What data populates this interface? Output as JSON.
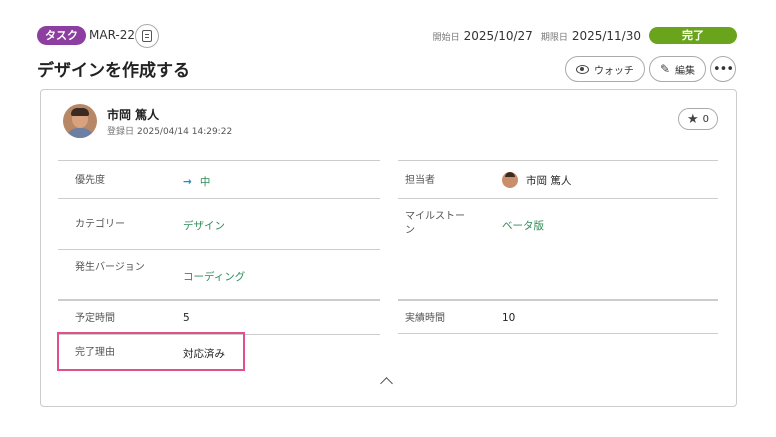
{
  "issue": {
    "type_label": "タスク",
    "key": "MAR-22",
    "title": "デザインを作成する",
    "start_label": "開始日",
    "start_date": "2025/10/27",
    "due_label": "期限日",
    "due_date": "2025/11/30",
    "status": "完了"
  },
  "actions": {
    "watch_label": "ウォッチ",
    "edit_label": "編集",
    "more_label": "•••"
  },
  "author": {
    "name": "市岡 篤人",
    "created_label": "登録日",
    "created_at": "2025/04/14 14:29:22",
    "star_count": "0"
  },
  "fields": {
    "priority": {
      "label": "優先度",
      "value": "中",
      "arrow": "→"
    },
    "assignee": {
      "label": "担当者",
      "value": "市岡 篤人"
    },
    "category": {
      "label": "カテゴリー",
      "value": "デザイン"
    },
    "milestone": {
      "label": "マイルストーン",
      "value": "ベータ版"
    },
    "version": {
      "label": "発生バージョン",
      "value": "コーディング"
    },
    "estimated": {
      "label": "予定時間",
      "value": "5"
    },
    "actual": {
      "label": "実績時間",
      "value": "10"
    },
    "resolution": {
      "label": "完了理由",
      "value": "対応済み"
    }
  },
  "colors": {
    "type_badge": "#8c3fa0",
    "status_done": "#6aa41d",
    "link_green": "#2e8b57",
    "highlight": "#e0508a"
  },
  "icons": [
    "copy-icon",
    "eye-icon",
    "pencil-icon",
    "more-icon",
    "star-icon",
    "arrow-right-icon",
    "chevron-up-icon"
  ]
}
